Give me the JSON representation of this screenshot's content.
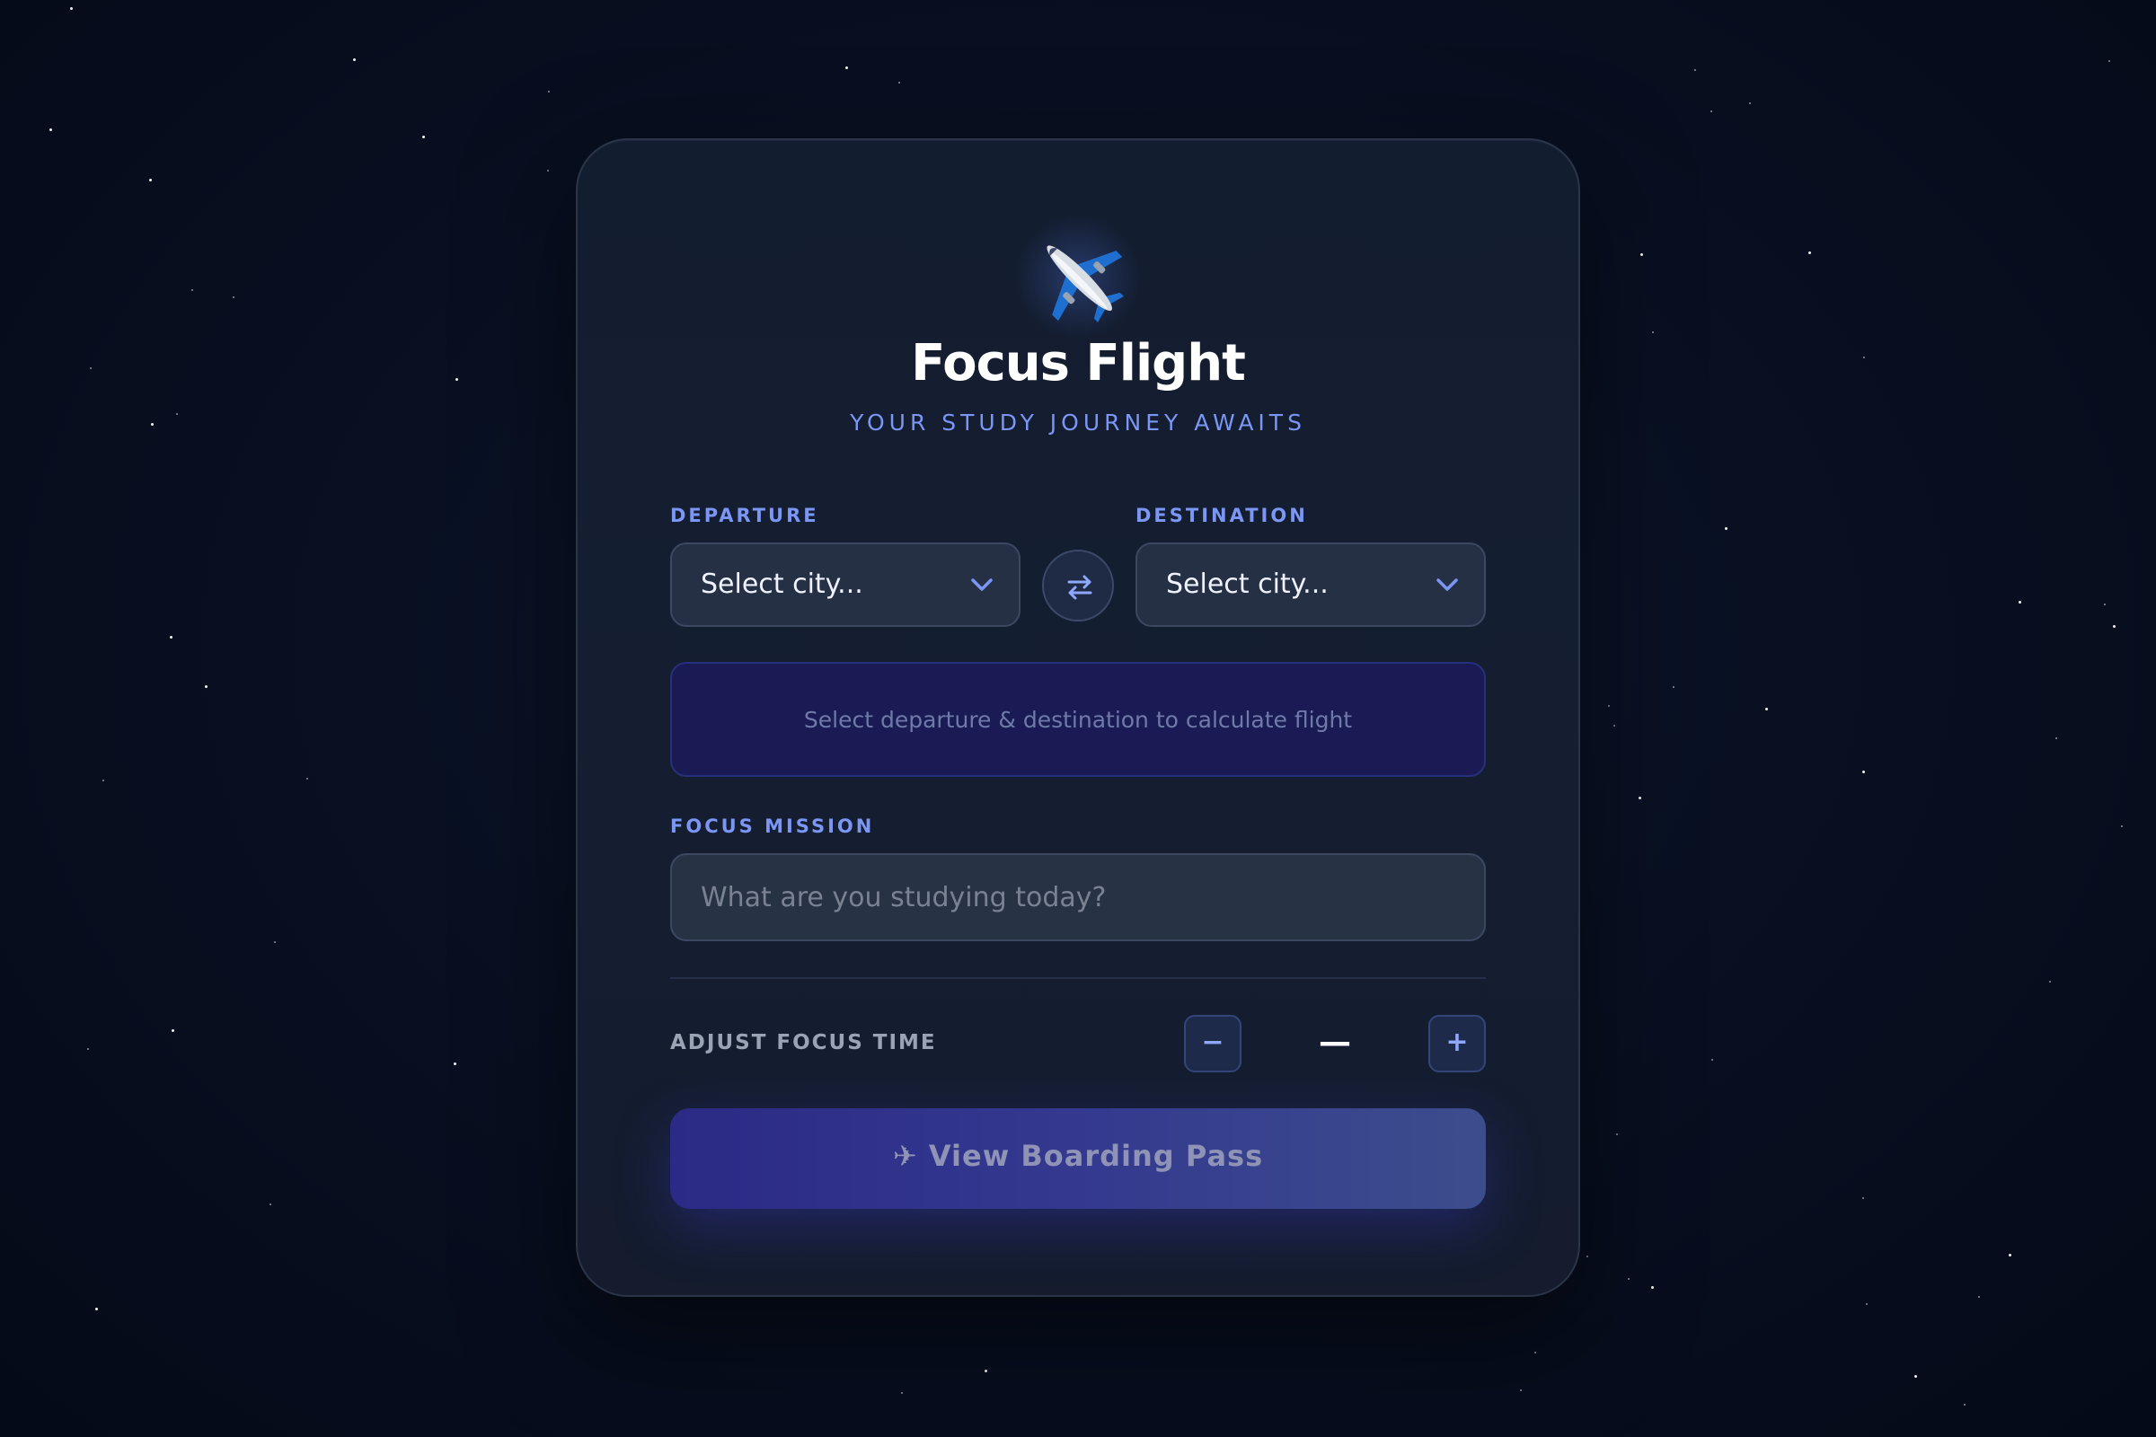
{
  "app": {
    "title": "Focus Flight",
    "subtitle": "YOUR STUDY JOURNEY AWAITS",
    "logo_icon": "airplane-icon"
  },
  "route": {
    "departure_label": "DEPARTURE",
    "departure_value": "Select city...",
    "destination_label": "DESTINATION",
    "destination_value": "Select city...",
    "swap_icon": "swap-arrows-icon",
    "dropdown_icon": "chevron-down-icon"
  },
  "flight_info": {
    "message": "Select departure & destination to calculate flight"
  },
  "mission": {
    "label": "FOCUS MISSION",
    "placeholder": "What are you studying today?",
    "value": ""
  },
  "focus_time": {
    "label": "ADJUST FOCUS TIME",
    "decrement": "−",
    "increment": "+",
    "value": "—"
  },
  "cta": {
    "label": "✈ View Boarding Pass",
    "enabled": false
  },
  "colors": {
    "accent": "#7b96f4",
    "background": "#060c1c",
    "card": "#141c2e",
    "info_box": "#1a1b55",
    "button_gradient_start": "#2b2a86",
    "button_gradient_end": "#3c4d8c"
  }
}
